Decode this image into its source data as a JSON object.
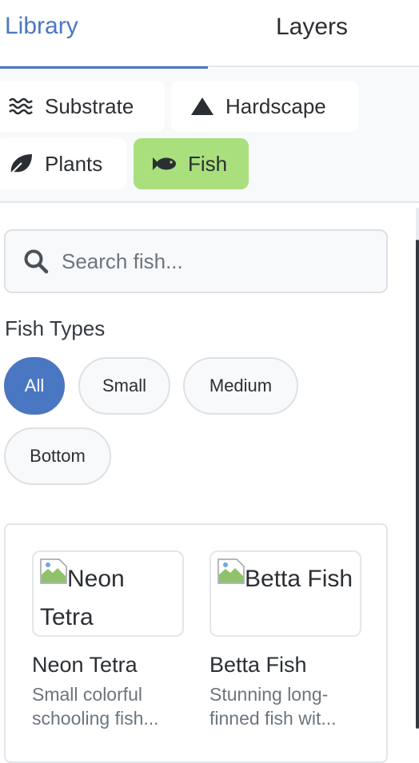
{
  "tabs": [
    {
      "label": "Library",
      "active": true
    },
    {
      "label": "Layers",
      "active": false
    }
  ],
  "categories": [
    {
      "label": "Substrate",
      "icon": "waves-icon",
      "active": false
    },
    {
      "label": "Hardscape",
      "icon": "mountain-icon",
      "active": false
    },
    {
      "label": "Plants",
      "icon": "leaf-icon",
      "active": false
    },
    {
      "label": "Fish",
      "icon": "fish-icon",
      "active": true
    }
  ],
  "search": {
    "placeholder": "Search fish...",
    "value": ""
  },
  "filters": {
    "title": "Fish Types",
    "chips": [
      {
        "label": "All",
        "active": true
      },
      {
        "label": "Small",
        "active": false
      },
      {
        "label": "Medium",
        "active": false
      },
      {
        "label": "Bottom",
        "active": false
      }
    ]
  },
  "fish": [
    {
      "alt": "Neon Tetra",
      "name": "Neon Tetra",
      "description": "Small colorful schooling fish..."
    },
    {
      "alt": "Betta Fish",
      "name": "Betta Fish",
      "description": "Stunning long-finned fish wit..."
    }
  ],
  "colors": {
    "accent": "#4a77c2",
    "active_category": "#a9df7d"
  }
}
